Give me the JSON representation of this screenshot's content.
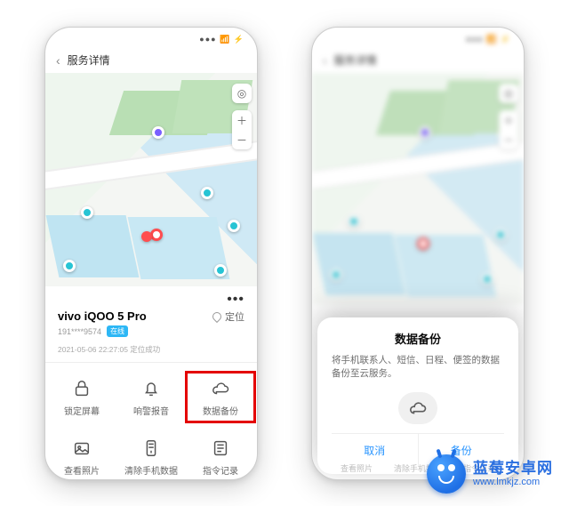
{
  "status": {
    "time_blur": " ",
    "icons": "●●● 📶 ⚡"
  },
  "nav": {
    "title": "服务详情"
  },
  "device": {
    "name": "vivo iQOO 5 Pro",
    "phone_masked": "191****9574",
    "online_label": "在线",
    "locate_label": "定位",
    "timestamp": "2021-05-06 22:27:05 定位成功"
  },
  "menu": {
    "more": "•••"
  },
  "actions": {
    "lock": {
      "label": "锁定屏幕"
    },
    "alarm": {
      "label": "响警报音"
    },
    "backup": {
      "label": "数据备份"
    },
    "photos": {
      "label": "查看照片"
    },
    "wipe": {
      "label": "清除手机数据"
    },
    "log": {
      "label": "指令记录"
    }
  },
  "dialog": {
    "title": "数据备份",
    "desc": "将手机联系人、短信、日程、便签的数据备份至云服务。",
    "cancel": "取消",
    "confirm": "备份"
  },
  "under": {
    "a": "查看照片",
    "b": "清除手机数据",
    "c": "指令记录"
  },
  "brand": {
    "cn": "蓝莓安卓网",
    "url": "www.lmkjz.com"
  }
}
